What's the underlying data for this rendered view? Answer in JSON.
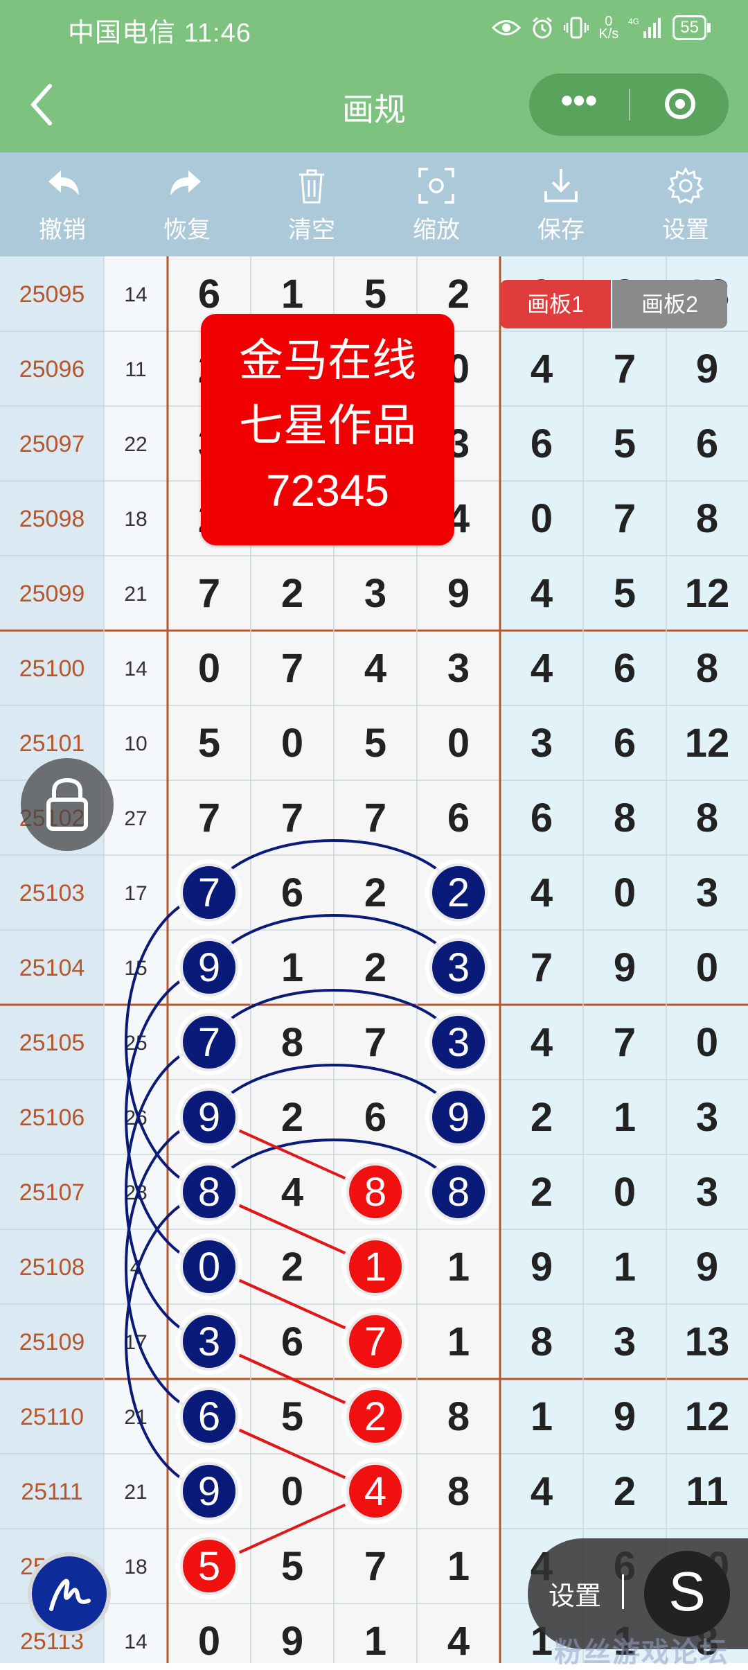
{
  "status_bar": {
    "carrier_time": "中国电信 11:46",
    "net_speed_value": "0",
    "net_speed_unit": "K/s",
    "signal": "4G",
    "battery": "55",
    "icons": [
      "eye-icon",
      "alarm-icon",
      "vibrate-icon",
      "signal-icon",
      "battery-icon"
    ]
  },
  "title_bar": {
    "back_label": "‹",
    "title": "画规",
    "more_label": "•••"
  },
  "toolbar": {
    "items": [
      {
        "label": "撤销",
        "icon": "undo-icon"
      },
      {
        "label": "恢复",
        "icon": "redo-icon"
      },
      {
        "label": "清空",
        "icon": "trash-icon"
      },
      {
        "label": "缩放",
        "icon": "zoom-icon"
      },
      {
        "label": "保存",
        "icon": "download-icon"
      },
      {
        "label": "设置",
        "icon": "gear-icon"
      }
    ]
  },
  "sticker": {
    "line1": "金马在线",
    "line2": "七星作品",
    "line3": "72345"
  },
  "board_tabs": {
    "board1": "画板1",
    "board2": "画板2"
  },
  "floating": {
    "settings_label": "设置",
    "s_label": "S",
    "watermark": "粉丝游戏论坛"
  },
  "colors": {
    "header_green": "#7dc27e",
    "toolbar_blue": "#abc9d8",
    "issue_red": "#b8552a",
    "marker_navy": "#0a1a78",
    "marker_red": "#f01010",
    "line_red": "#e01818"
  },
  "grid": {
    "rows": [
      {
        "issue": "25095",
        "sum": "14",
        "d": [
          "6",
          "1",
          "5",
          "2",
          "9",
          "3",
          "13"
        ]
      },
      {
        "issue": "25096",
        "sum": "11",
        "d": [
          "2",
          "",
          "",
          "0",
          "4",
          "7",
          "9"
        ]
      },
      {
        "issue": "25097",
        "sum": "22",
        "d": [
          "3",
          "",
          "",
          "3",
          "6",
          "5",
          "6"
        ]
      },
      {
        "issue": "25098",
        "sum": "18",
        "d": [
          "2",
          "",
          "",
          "4",
          "0",
          "7",
          "8"
        ]
      },
      {
        "issue": "25099",
        "sum": "21",
        "d": [
          "7",
          "2",
          "3",
          "9",
          "4",
          "5",
          "12"
        ]
      },
      {
        "issue": "25100",
        "sum": "14",
        "d": [
          "0",
          "7",
          "4",
          "3",
          "4",
          "6",
          "8"
        ]
      },
      {
        "issue": "25101",
        "sum": "10",
        "d": [
          "5",
          "0",
          "5",
          "0",
          "3",
          "6",
          "12"
        ]
      },
      {
        "issue": "25102",
        "sum": "27",
        "d": [
          "7",
          "7",
          "7",
          "6",
          "6",
          "8",
          "8"
        ]
      },
      {
        "issue": "25103",
        "sum": "17",
        "d": [
          "7",
          "6",
          "2",
          "2",
          "4",
          "0",
          "3"
        ]
      },
      {
        "issue": "25104",
        "sum": "15",
        "d": [
          "9",
          "1",
          "2",
          "3",
          "7",
          "9",
          "0"
        ]
      },
      {
        "issue": "25105",
        "sum": "25",
        "d": [
          "7",
          "8",
          "7",
          "3",
          "4",
          "7",
          "0"
        ]
      },
      {
        "issue": "25106",
        "sum": "26",
        "d": [
          "9",
          "2",
          "6",
          "9",
          "2",
          "1",
          "3"
        ]
      },
      {
        "issue": "25107",
        "sum": "28",
        "d": [
          "8",
          "4",
          "8",
          "8",
          "2",
          "0",
          "3"
        ]
      },
      {
        "issue": "25108",
        "sum": "4",
        "d": [
          "0",
          "2",
          "1",
          "1",
          "9",
          "1",
          "9"
        ]
      },
      {
        "issue": "25109",
        "sum": "17",
        "d": [
          "3",
          "6",
          "7",
          "1",
          "8",
          "3",
          "13"
        ]
      },
      {
        "issue": "25110",
        "sum": "21",
        "d": [
          "6",
          "5",
          "2",
          "8",
          "1",
          "9",
          "12"
        ]
      },
      {
        "issue": "25111",
        "sum": "21",
        "d": [
          "9",
          "0",
          "4",
          "8",
          "4",
          "2",
          "11"
        ]
      },
      {
        "issue": "25112",
        "sum": "18",
        "d": [
          "5",
          "5",
          "7",
          "1",
          "4",
          "6",
          "10"
        ]
      },
      {
        "issue": "25113",
        "sum": "14",
        "d": [
          "0",
          "9",
          "1",
          "4",
          "1",
          "1",
          "8"
        ]
      }
    ],
    "navy_circles": [
      [
        8,
        0
      ],
      [
        8,
        3
      ],
      [
        9,
        0
      ],
      [
        9,
        3
      ],
      [
        10,
        0
      ],
      [
        10,
        3
      ],
      [
        11,
        0
      ],
      [
        11,
        3
      ],
      [
        12,
        0
      ],
      [
        12,
        3
      ],
      [
        13,
        0
      ],
      [
        14,
        0
      ],
      [
        15,
        0
      ],
      [
        16,
        0
      ]
    ],
    "red_circles": [
      [
        12,
        2
      ],
      [
        13,
        2
      ],
      [
        14,
        2
      ],
      [
        15,
        2
      ],
      [
        16,
        2
      ],
      [
        17,
        0
      ]
    ],
    "red_links": [
      [
        11,
        0,
        12,
        2
      ],
      [
        12,
        0,
        13,
        2
      ],
      [
        13,
        0,
        14,
        2
      ],
      [
        14,
        0,
        15,
        2
      ],
      [
        15,
        0,
        16,
        2
      ],
      [
        13,
        2,
        12,
        0
      ],
      [
        14,
        2,
        13,
        0
      ],
      [
        15,
        2,
        14,
        0
      ],
      [
        16,
        2,
        15,
        0
      ],
      [
        16,
        2,
        17,
        0
      ]
    ],
    "navy_arcs_over": [
      [
        8,
        0,
        8,
        3
      ],
      [
        9,
        0,
        9,
        3
      ],
      [
        10,
        0,
        10,
        3
      ],
      [
        11,
        0,
        11,
        3
      ],
      [
        12,
        0,
        12,
        3
      ]
    ],
    "navy_arcs_left": [
      [
        8,
        0,
        12,
        0
      ],
      [
        9,
        0,
        13,
        0
      ],
      [
        10,
        0,
        14,
        0
      ],
      [
        11,
        0,
        15,
        0
      ],
      [
        12,
        0,
        16,
        0
      ]
    ]
  }
}
